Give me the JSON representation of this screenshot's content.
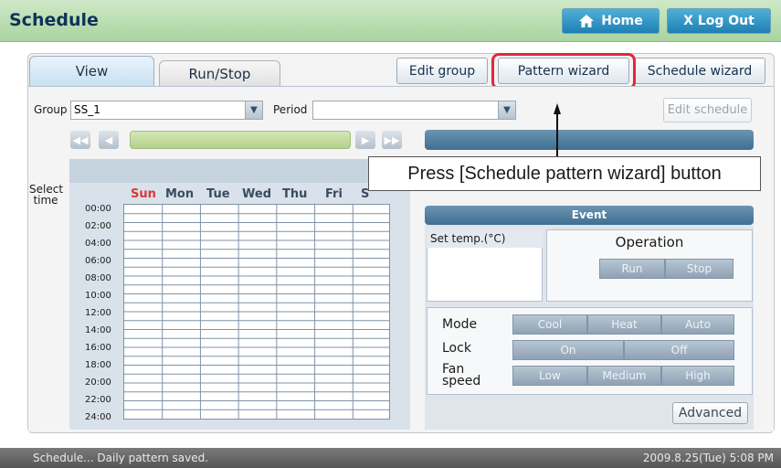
{
  "header": {
    "title": "Schedule",
    "home_label": "Home",
    "logout_label": "X Log Out"
  },
  "tabs": [
    {
      "label": "View",
      "active": true
    },
    {
      "label": "Run/Stop",
      "active": false
    }
  ],
  "toolbar": {
    "edit_group": "Edit group",
    "pattern_wizard": "Pattern wizard",
    "schedule_wizard": "Schedule wizard"
  },
  "filters": {
    "group_label": "Group",
    "group_value": "SS_1",
    "period_label": "Period",
    "period_value": "",
    "edit_schedule": "Edit schedule"
  },
  "schedule": {
    "select_time": "Select time",
    "days": [
      "Sun",
      "Mon",
      "Tue",
      "Wed",
      "Thu",
      "Fri",
      "S"
    ],
    "times": [
      "00:00",
      "02:00",
      "04:00",
      "06:00",
      "08:00",
      "10:00",
      "12:00",
      "14:00",
      "16:00",
      "18:00",
      "20:00",
      "22:00",
      "24:00"
    ]
  },
  "callout": {
    "text": "Press [Schedule pattern wizard] button"
  },
  "event": {
    "title": "Event",
    "set_temp_label": "Set temp.(°C)",
    "operation_label": "Operation",
    "run": "Run",
    "stop": "Stop",
    "mode_label": "Mode",
    "modes": [
      "Cool",
      "Heat",
      "Auto"
    ],
    "lock_label": "Lock",
    "lock_options": [
      "On",
      "Off"
    ],
    "fan_label": "Fan speed",
    "fan_options": [
      "Low",
      "Medium",
      "High"
    ],
    "advanced": "Advanced"
  },
  "status": {
    "message": "Schedule... Daily pattern saved.",
    "datetime": "2009.8.25(Tue) 5:08 PM"
  },
  "colors": {
    "accent_red": "#e0283e",
    "header_green": "#a9d4a0",
    "title_navy": "#0f3358"
  }
}
